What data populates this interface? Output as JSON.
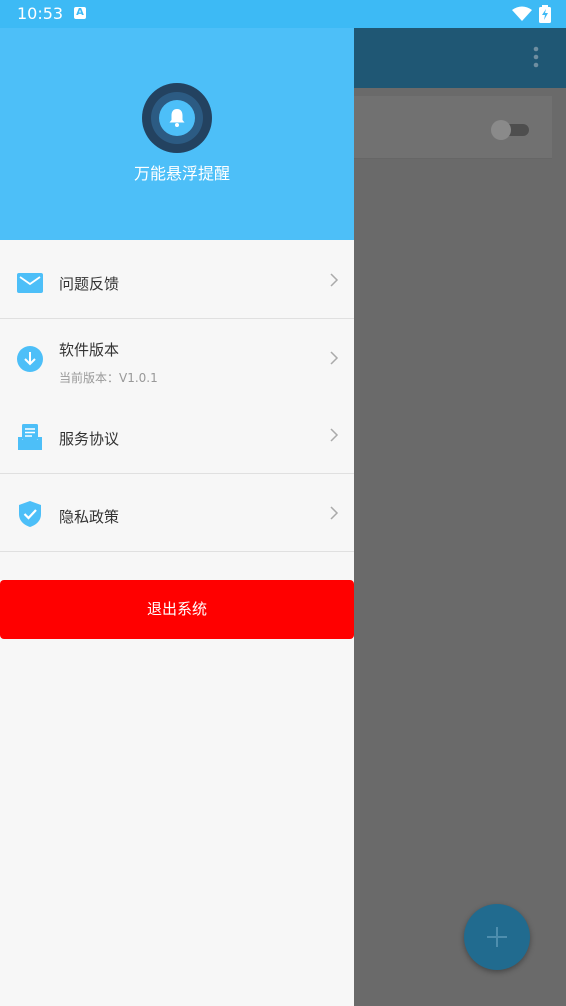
{
  "status_bar": {
    "time": "10:53",
    "notification_icon": "A"
  },
  "drawer": {
    "app_name": "万能悬浮提醒",
    "menu": [
      {
        "label": "问题反馈",
        "icon": "mail-icon"
      },
      {
        "label": "软件版本",
        "sub": "当前版本：V1.0.1",
        "icon": "download-icon"
      },
      {
        "label": "服务协议",
        "icon": "document-icon"
      },
      {
        "label": "隐私政策",
        "icon": "shield-check-icon"
      }
    ],
    "logout_label": "退出系统"
  },
  "colors": {
    "header": "#4dbff8",
    "logout": "#ff0000",
    "icon_accent": "#4dbff8"
  }
}
